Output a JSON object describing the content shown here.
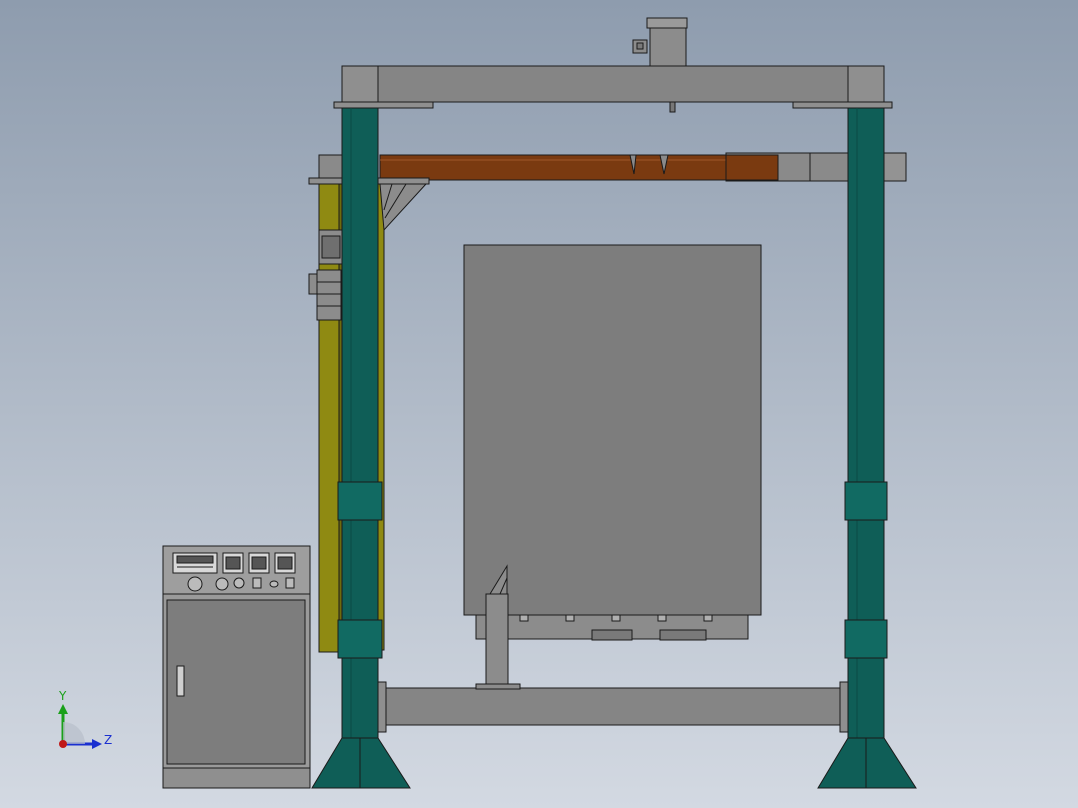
{
  "viewport": {
    "background_top": "#8e9cae",
    "background_bottom": "#d3d9e2"
  },
  "colors": {
    "frame_teal": "#0f5e57",
    "frame_grey": "#8a8a8a",
    "beam_brown": "#7a3a10",
    "rail_olive": "#8f8a12",
    "panel_grey": "#7d7d7d",
    "edge": "#1a1a1a"
  },
  "triad": {
    "y_label": "Y",
    "z_label": "Z",
    "y_color": "#1aa01a",
    "z_color": "#1a2fd0",
    "origin_color": "#c01818"
  },
  "control_cabinet": {
    "display_icon": "digital-display-icon",
    "gauge_icons": [
      "gauge-icon",
      "gauge-icon",
      "gauge-icon"
    ],
    "knob_icons": [
      "knob-icon",
      "knob-icon",
      "button-icon",
      "button-icon",
      "button-icon",
      "button-icon"
    ],
    "handle_icon": "door-handle-icon"
  }
}
